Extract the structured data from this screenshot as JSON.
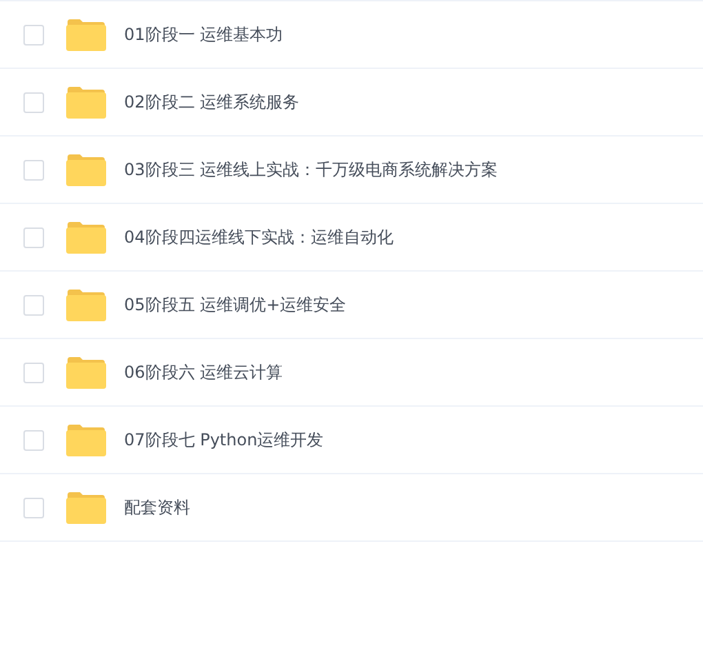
{
  "files": [
    {
      "name": "01阶段一 运维基本功",
      "checked": false
    },
    {
      "name": "02阶段二 运维系统服务",
      "checked": false
    },
    {
      "name": "03阶段三 运维线上实战：千万级电商系统解决方案",
      "checked": false
    },
    {
      "name": "04阶段四运维线下实战：运维自动化",
      "checked": false
    },
    {
      "name": "05阶段五 运维调优+运维安全",
      "checked": false
    },
    {
      "name": "06阶段六 运维云计算",
      "checked": false
    },
    {
      "name": "07阶段七 Python运维开发",
      "checked": false
    },
    {
      "name": "配套资料",
      "checked": false
    }
  ]
}
